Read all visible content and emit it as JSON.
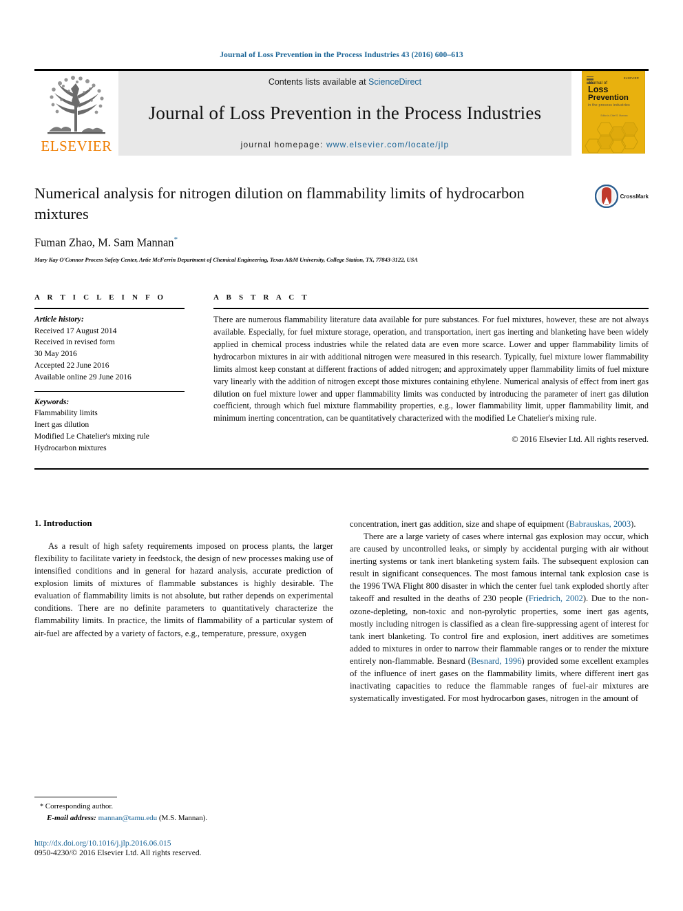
{
  "running_head": "Journal of Loss Prevention in the Process Industries 43 (2016) 600–613",
  "masthead": {
    "publisher_name": "ELSEVIER",
    "contents_prefix": "Contents lists available at",
    "contents_link": "ScienceDirect",
    "journal_title": "Journal of Loss Prevention in the Process Industries",
    "homepage_prefix": "journal homepage:",
    "homepage_url": "www.elsevier.com/locate/jlp",
    "cover": {
      "brand": "ELSEVIER",
      "line1": "Journal of",
      "line2": "Loss",
      "line3": "Prevention",
      "line4": "in the process industries",
      "editor_note": "Editor-in-Chief\nS. Mannan"
    }
  },
  "article": {
    "title": "Numerical analysis for nitrogen dilution on flammability limits of hydrocarbon mixtures",
    "authors": "Fuman Zhao, M. Sam Mannan",
    "author_marker": "*",
    "affiliation": "Mary Kay O'Connor Process Safety Center, Artie McFerrin Department of Chemical Engineering, Texas A&M University, College Station, TX, 77843-3122, USA",
    "crossmark_label": "CrossMark"
  },
  "article_info": {
    "heading": "A R T I C L E   I N F O",
    "history_label": "Article history:",
    "history": [
      "Received 17 August 2014",
      "Received in revised form",
      "30 May 2016",
      "Accepted 22 June 2016",
      "Available online 29 June 2016"
    ],
    "keywords_label": "Keywords:",
    "keywords": [
      "Flammability limits",
      "Inert gas dilution",
      "Modified Le Chatelier's mixing rule",
      "Hydrocarbon mixtures"
    ]
  },
  "abstract": {
    "heading": "A B S T R A C T",
    "body": "There are numerous flammability literature data available for pure substances. For fuel mixtures, however, these are not always available. Especially, for fuel mixture storage, operation, and transportation, inert gas inerting and blanketing have been widely applied in chemical process industries while the related data are even more scarce. Lower and upper flammability limits of hydrocarbon mixtures in air with additional nitrogen were measured in this research. Typically, fuel mixture lower flammability limits almost keep constant at different fractions of added nitrogen; and approximately upper flammability limits of fuel mixture vary linearly with the addition of nitrogen except those mixtures containing ethylene. Numerical analysis of effect from inert gas dilution on fuel mixture lower and upper flammability limits was conducted by introducing the parameter of inert gas dilution coefficient, through which fuel mixture flammability properties, e.g., lower flammability limit, upper flammability limit, and minimum inerting concentration, can be quantitatively characterized with the modified Le Chatelier's mixing rule.",
    "copyright": "© 2016 Elsevier Ltd. All rights reserved."
  },
  "introduction": {
    "heading": "1. Introduction",
    "left_paragraph": "As a result of high safety requirements imposed on process plants, the larger flexibility to facilitate variety in feedstock, the design of new processes making use of intensified conditions and in general for hazard analysis, accurate prediction of explosion limits of mixtures of flammable substances is highly desirable. The evaluation of flammability limits is not absolute, but rather depends on experimental conditions. There are no definite parameters to quantitatively characterize the flammability limits. In practice, the limits of flammability of a particular system of air-fuel are affected by a variety of factors, e.g., temperature, pressure, oxygen",
    "right_continuation_a": "concentration, inert gas addition, size and shape of equipment (",
    "right_citation_a": "Babrauskas, 2003",
    "right_continuation_b": ").",
    "right_paragraph_pre1": "There are a large variety of cases where internal gas explosion may occur, which are caused by uncontrolled leaks, or simply by accidental purging with air without inerting systems or tank inert blanketing system fails. The subsequent explosion can result in significant consequences. The most famous internal tank explosion case is the 1996 TWA Flight 800 disaster in which the center fuel tank exploded shortly after takeoff and resulted in the deaths of 230 people (",
    "right_citation_b": "Friedrich, 2002",
    "right_paragraph_pre2": "). Due to the non-ozone-depleting, non-toxic and non-pyrolytic properties, some inert gas agents, mostly including nitrogen is classified as a clean fire-suppressing agent of interest for tank inert blanketing. To control fire and explosion, inert additives are sometimes added to mixtures in order to narrow their flammable ranges or to render the mixture entirely non-flammable. Besnard (",
    "right_citation_c": "Besnard, 1996",
    "right_paragraph_pre3": ") provided some excellent examples of the influence of inert gases on the flammability limits, where different inert gas inactivating capacities to reduce the flammable ranges of fuel-air mixtures are systematically investigated. For most hydrocarbon gases, nitrogen in the amount of"
  },
  "footnote": {
    "corresponding_marker": "*",
    "corresponding_text": "Corresponding author.",
    "email_label": "E-mail address:",
    "email": "mannan@tamu.edu",
    "email_suffix": "(M.S. Mannan)."
  },
  "footer": {
    "doi": "http://dx.doi.org/10.1016/j.jlp.2016.06.015",
    "issn_line": "0950-4230/© 2016 Elsevier Ltd. All rights reserved."
  },
  "colors": {
    "link": "#1a6496",
    "elsevier_orange": "#ef7d00",
    "cover_yellow": "#e8b10e",
    "masthead_grey": "#e8e8e8"
  }
}
